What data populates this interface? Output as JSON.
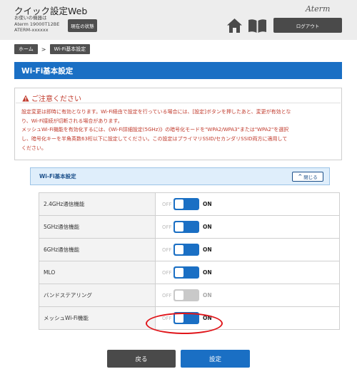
{
  "header": {
    "app_title": "クイック設定Web",
    "device_label": "お使いの機器は",
    "device_model": "Aterm 19000T12BE",
    "device_name": "ATERM-xxxxxx",
    "status_button": "現在の状態",
    "brand": "Aterm",
    "home_icon": "home-icon",
    "manual_icon": "book-icon",
    "logout_button": "ログアウト"
  },
  "breadcrumb": {
    "home": "ホーム",
    "separator": ">",
    "current": "Wi-Fi基本設定"
  },
  "page_title": "Wi-Fi基本設定",
  "notice": {
    "title": "ご注意ください",
    "lines": [
      "設定変更は即時に有効となります。Wi-Fi経由で設定を行っている場合には、[設定]ボタンを押したあと、変更が有効とな",
      "り、Wi-Fi接続が切断される場合があります。",
      "メッシュWi-Fi機能を有効化するには、《Wi-Fi詳細設定(5GHz)》の暗号化モードを\"WPA2/WPA3\"または\"WPA2\"を選択",
      "し、暗号化キーを半角英数63桁以下に設定してください。この設定はプライマリSSID/セカンダリSSID両方に適用して",
      "ください。"
    ]
  },
  "section": {
    "title": "Wi-Fi基本設定",
    "close_button": "閉じる"
  },
  "toggle_labels": {
    "off": "OFF",
    "on": "ON"
  },
  "settings": [
    {
      "label": "2.4GHz通信機能",
      "state": "ON",
      "enabled": true
    },
    {
      "label": "5GHz通信機能",
      "state": "ON",
      "enabled": true
    },
    {
      "label": "6GHz通信機能",
      "state": "ON",
      "enabled": true
    },
    {
      "label": "MLO",
      "state": "ON",
      "enabled": true
    },
    {
      "label": "バンドステアリング",
      "state": "ON",
      "enabled": false
    },
    {
      "label": "メッシュWi-Fi機能",
      "state": "ON",
      "enabled": true
    }
  ],
  "footer": {
    "back_button": "戻る",
    "submit_button": "設定"
  },
  "colors": {
    "accent": "#1a6fc4",
    "warning": "#c0392b",
    "highlight": "#e0151a"
  }
}
